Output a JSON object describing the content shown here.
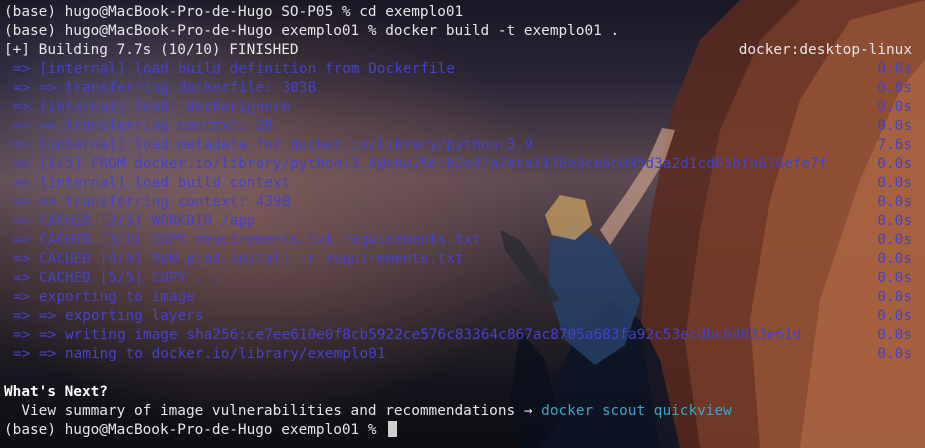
{
  "prompt_lines": [
    "(base) hugo@MacBook-Pro-de-Hugo SO-P05 % cd exemplo01",
    "(base) hugo@MacBook-Pro-de-Hugo exemplo01 % docker build -t exemplo01 ."
  ],
  "build_header": {
    "status": "[+] Building 7.7s (10/10) FINISHED",
    "builder": "docker:desktop-linux"
  },
  "build_steps": [
    {
      "text": "=> [internal] load build definition from Dockerfile",
      "time": "0.0s"
    },
    {
      "text": "=> => transferring dockerfile: 303B",
      "time": "0.0s"
    },
    {
      "text": "=> [internal] load .dockerignore",
      "time": "0.0s"
    },
    {
      "text": "=> => transferring context: 2B",
      "time": "0.0s"
    },
    {
      "text": "=> [internal] load metadata for docker.io/library/python:3.9",
      "time": "7.6s"
    },
    {
      "text": "=> [1/5] FROM docker.io/library/python:3.9@sha256:b2e47a7eca3178e4ce6c095d3a2d1cd05bfa616efe7f",
      "time": "0.0s"
    },
    {
      "text": "=> [internal] load build context",
      "time": "0.0s"
    },
    {
      "text": "=> => transferring context: 439B",
      "time": "0.0s"
    },
    {
      "text": "=> CACHED [2/5] WORKDIR /app",
      "time": "0.0s"
    },
    {
      "text": "=> CACHED [3/5] COPY requirements.txt requirements.txt",
      "time": "0.0s"
    },
    {
      "text": "=> CACHED [4/5] RUN pip3 install -r requirements.txt",
      "time": "0.0s"
    },
    {
      "text": "=> CACHED [5/5] COPY . .",
      "time": "0.0s"
    },
    {
      "text": "=> exporting to image",
      "time": "0.0s"
    },
    {
      "text": "=> => exporting layers",
      "time": "0.0s"
    },
    {
      "text": "=> => writing image sha256:ce7ee610e0f8cb5922ce576c83364c867ac8705a683fa92c53ecdbc64033e61d",
      "time": "0.0s"
    },
    {
      "text": "=> => naming to docker.io/library/exemplo01",
      "time": "0.0s"
    }
  ],
  "whats_next": {
    "title": "What's Next?",
    "message": "  View summary of image vulnerabilities and recommendations → ",
    "command": "docker scout quickview"
  },
  "final_prompt": "(base) hugo@MacBook-Pro-de-Hugo exemplo01 % ",
  "colors": {
    "text": "#e6e6e6",
    "dim_output": "#4542c6",
    "link": "#38a6c8",
    "cursor": "#cfcfcf"
  }
}
